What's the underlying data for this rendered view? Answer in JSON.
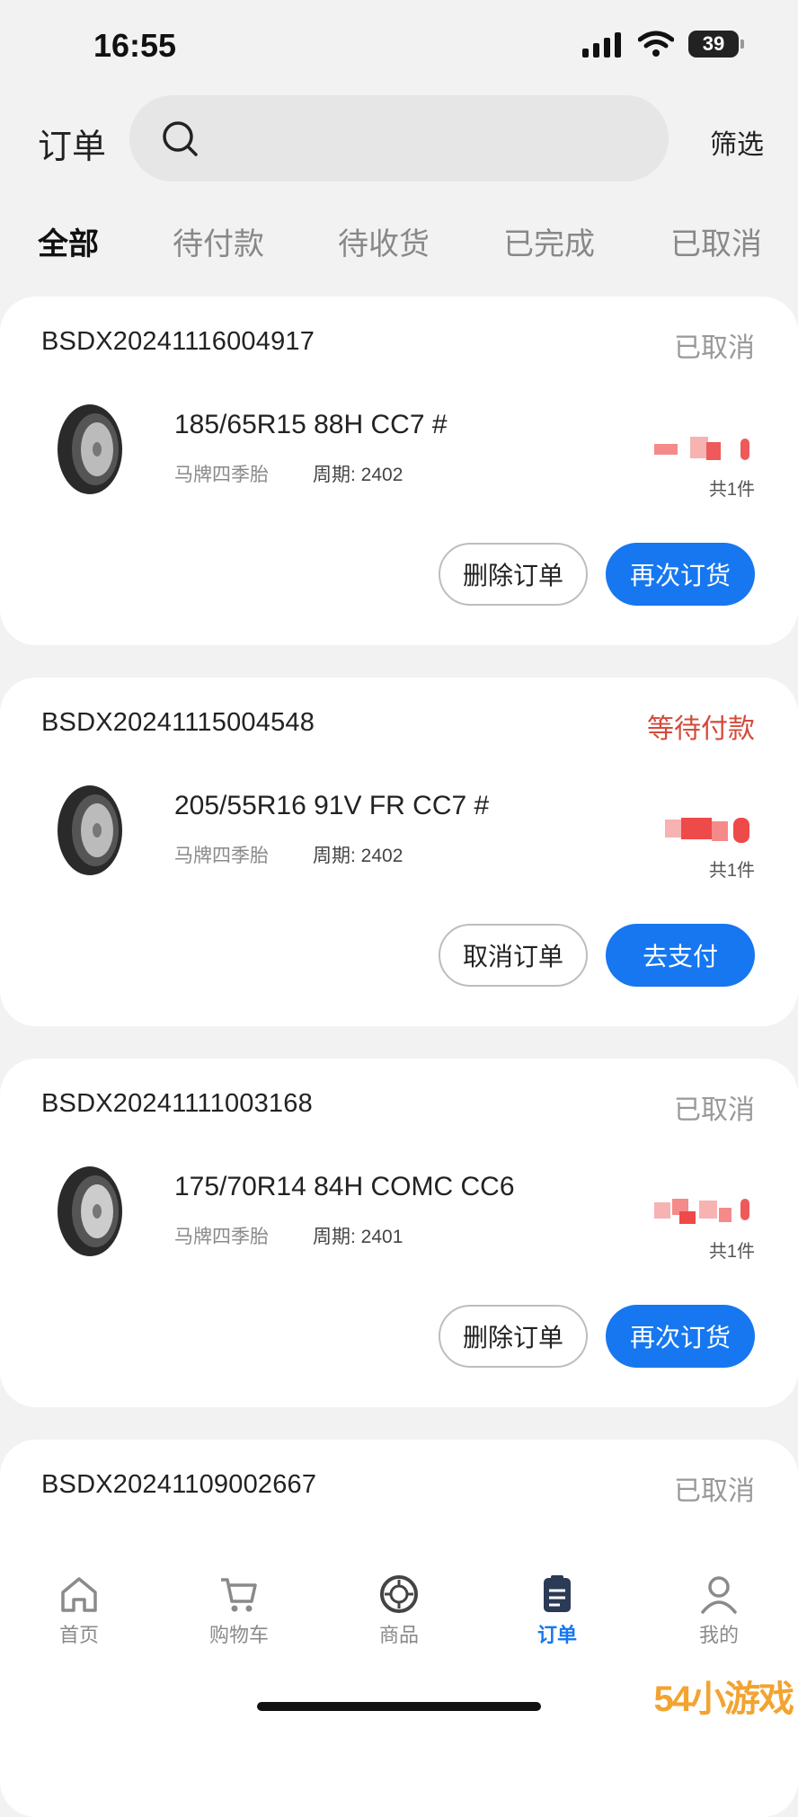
{
  "status_bar": {
    "time": "16:55",
    "battery": "39"
  },
  "header": {
    "title": "订单",
    "filter_label": "筛选"
  },
  "tabs": [
    {
      "label": "全部",
      "active": true
    },
    {
      "label": "待付款",
      "active": false
    },
    {
      "label": "待收货",
      "active": false
    },
    {
      "label": "已完成",
      "active": false
    },
    {
      "label": "已取消",
      "active": false
    }
  ],
  "orders": [
    {
      "order_no": "BSDX20241116004917",
      "status": "已取消",
      "product": "185/65R15 88H CC7 #",
      "brand": "马牌四季胎",
      "cycle": "周期: 2402",
      "qty": "共1件",
      "btn_secondary": "删除订单",
      "btn_primary": "再次订货"
    },
    {
      "order_no": "BSDX20241115004548",
      "status": "等待付款",
      "product": "205/55R16 91V FR CC7 #",
      "brand": "马牌四季胎",
      "cycle": "周期: 2402",
      "qty": "共1件",
      "btn_secondary": "取消订单",
      "btn_primary": "去支付"
    },
    {
      "order_no": "BSDX20241111003168",
      "status": "已取消",
      "product": "175/70R14 84H COMC CC6",
      "brand": "马牌四季胎",
      "cycle": "周期: 2401",
      "qty": "共1件",
      "btn_secondary": "删除订单",
      "btn_primary": "再次订货"
    },
    {
      "order_no": "BSDX20241109002667",
      "status": "已取消"
    }
  ],
  "bottom_nav": [
    {
      "label": "首页",
      "icon": "home-icon",
      "active": false
    },
    {
      "label": "购物车",
      "icon": "cart-icon",
      "active": false
    },
    {
      "label": "商品",
      "icon": "tire-icon",
      "active": false
    },
    {
      "label": "订单",
      "icon": "order-icon",
      "active": true
    },
    {
      "label": "我的",
      "icon": "profile-icon",
      "active": false
    }
  ],
  "colors": {
    "accent": "#1677f0",
    "pending": "#d44a3a",
    "muted": "#999999"
  },
  "watermark": "54小游戏"
}
